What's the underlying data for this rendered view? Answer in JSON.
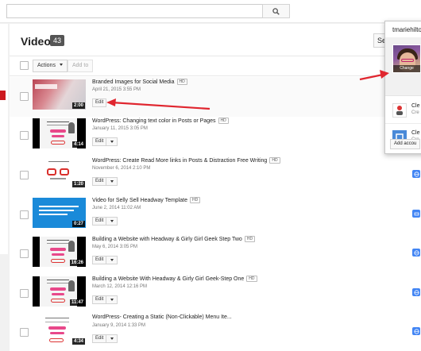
{
  "search": {
    "value": "",
    "placeholder": ""
  },
  "header": {
    "title": "Videos",
    "count": "43",
    "sort_label": "Sea"
  },
  "toolbar": {
    "actions_label": "Actions",
    "add_to_label": "Add to"
  },
  "videos": [
    {
      "title": "Branded Images for Social Media",
      "hd": "HD",
      "date": "April 21, 2015 3:55 PM",
      "duration": "2:00",
      "edit_label": "Edit",
      "privacy_icon": ""
    },
    {
      "title": "WordPress: Changing text color in Posts or Pages",
      "hd": "HD",
      "date": "January 11, 2015 3:05 PM",
      "duration": "4:14",
      "edit_label": "Edit",
      "privacy_icon": "public-icon"
    },
    {
      "title": "WordPress: Create Read More links in Posts & Distraction Free Writing",
      "hd": "HD",
      "date": "November 6, 2014 2:10 PM",
      "duration": "1:20",
      "edit_label": "Edit",
      "privacy_icon": "public-icon"
    },
    {
      "title": "Video for Selly Sell Headway Template",
      "hd": "HD",
      "date": "June 2, 2014 11:02 AM",
      "duration": "0:27",
      "edit_label": "Edit",
      "privacy_icon": "unlisted-icon"
    },
    {
      "title": "Building a Website with Headway & Girly Girl Geek Step Two",
      "hd": "HD",
      "date": "May 6, 2014 3:05 PM",
      "duration": "16:26",
      "edit_label": "Edit",
      "privacy_icon": "public-icon"
    },
    {
      "title": "Building a Website With Headway & Girly Girl Geek-Step One",
      "hd": "HD",
      "date": "March 12, 2014 12:16 PM",
      "duration": "11:47",
      "edit_label": "Edit",
      "privacy_icon": "public-icon"
    },
    {
      "title": "WordPress- Creating a Static (Non-Clickable) Menu Ite...",
      "hd": "",
      "date": "January 9, 2014 1:33 PM",
      "duration": "4:34",
      "edit_label": "Edit",
      "privacy_icon": "public-icon"
    }
  ],
  "account_popup": {
    "username": "tmariehilton",
    "change_label": "Change",
    "accounts": [
      {
        "name": "Cle",
        "sub": "Cre"
      },
      {
        "name": "Cle",
        "sub": "Cre"
      }
    ],
    "add_account_label": "Add accou"
  },
  "annotations": {
    "arrow_color": "#e0262f"
  }
}
